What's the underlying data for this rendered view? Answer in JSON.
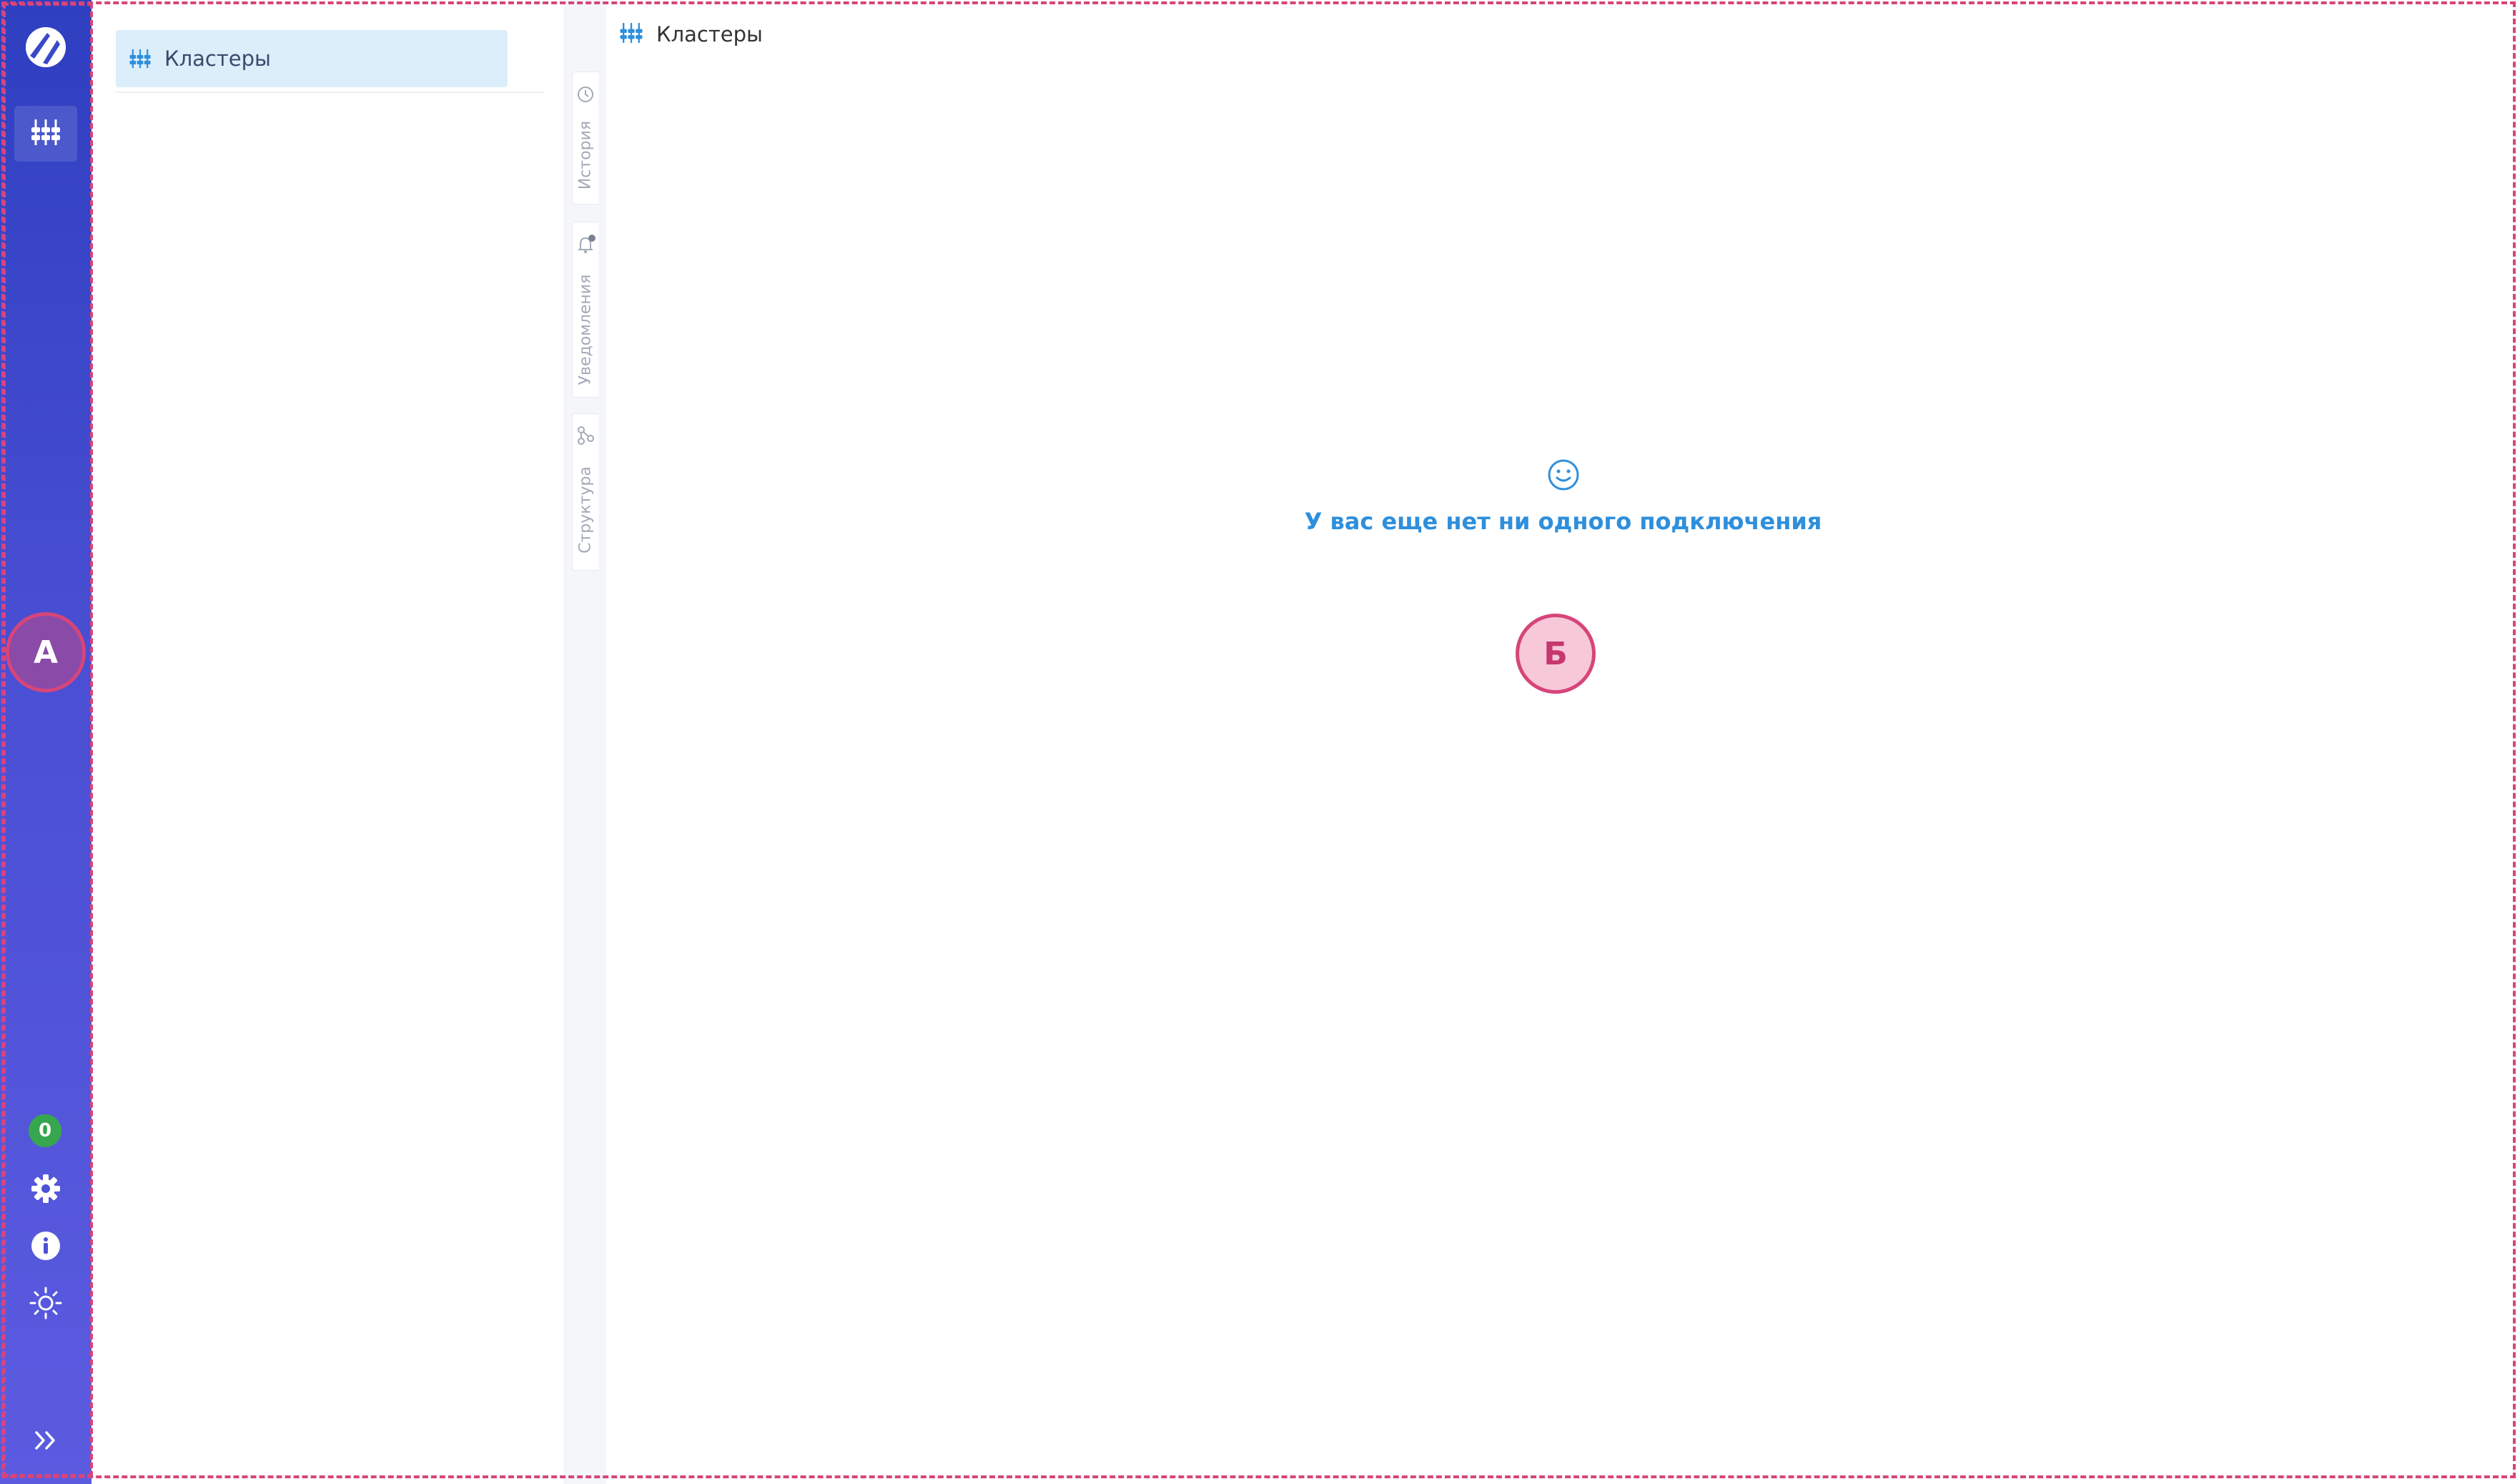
{
  "rail": {
    "badge_count": "0",
    "icons": [
      "logo-icon",
      "clusters-icon",
      "settings-icon",
      "info-icon",
      "theme-icon",
      "expand-icon"
    ]
  },
  "sidebar": {
    "items": [
      {
        "label": "Кластеры",
        "icon": "clusters-icon",
        "active": true
      }
    ]
  },
  "vertical_tabs": [
    {
      "label": "История",
      "icon": "history-icon"
    },
    {
      "label": "Уведомления",
      "icon": "bell-icon"
    },
    {
      "label": "Структура",
      "icon": "structure-icon"
    }
  ],
  "main": {
    "title": "Кластеры",
    "empty_state": {
      "icon": "smiley-icon",
      "message": "У вас еще нет ни одного подключения"
    }
  },
  "annotations": {
    "marker_a": "А",
    "marker_b": "Б"
  },
  "colors": {
    "accent": "#2e8fdc",
    "rail_top": "#2e3fc0",
    "rail_bottom": "#5b5be0",
    "active_item": "#dbeefa",
    "badge": "#36a64f",
    "annotation": "#d6457a"
  }
}
